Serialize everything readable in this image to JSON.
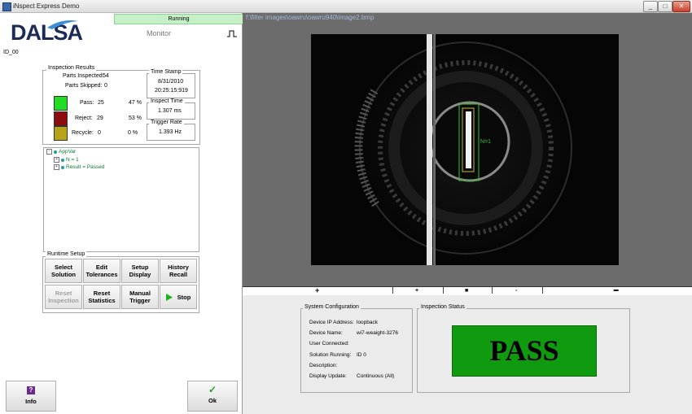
{
  "window": {
    "title": "iNspect Express Demo",
    "controls": [
      "_",
      "□",
      "✕"
    ]
  },
  "status": "Running",
  "logo": "DALSA",
  "monitor_label": "Monitor",
  "id_label": "ID_00",
  "results": {
    "title": "Inspection Results",
    "parts_inspected_label": "Parts Inspected:",
    "parts_inspected": "54",
    "parts_skipped_label": "Parts Skipped:",
    "parts_skipped": "0",
    "rows": [
      {
        "label": "Pass:",
        "count": "25",
        "percent": "47 %",
        "color": "#22dd22"
      },
      {
        "label": "Reject:",
        "count": "29",
        "percent": "53 %",
        "color": "#8b0d0d"
      },
      {
        "label": "Recycle:",
        "count": "0",
        "percent": "0 %",
        "color": "#b8a41c"
      }
    ],
    "timestamp_title": "Time Stamp",
    "date": "8/31/2010",
    "time": "20:25:15:919",
    "inspect_time_title": "Inspect Time",
    "inspect_time": "1.307 ms",
    "trigger_rate_title": "Trigger Rate",
    "trigger_rate": "1.393 Hz"
  },
  "tree": {
    "root": "AppVar",
    "children": [
      "N = 1",
      "Result = Passed"
    ]
  },
  "runtime": {
    "title": "Runtime Setup",
    "buttons": [
      "Select\nSolution",
      "Edit\nTolerances",
      "Setup\nDisplay",
      "History\nRecall",
      "Reset\nInspection",
      "Reset\nStatistics",
      "Manual\nTrigger",
      "Stop"
    ]
  },
  "bottom_buttons": {
    "info_label": "Info",
    "info_icon": "?",
    "ok_label": "Ok",
    "ok_icon": "✓"
  },
  "image": {
    "path": "f:\\filter images\\oawru\\oawru940\\image2.bmp",
    "overlay_label": "N=1"
  },
  "ruler_symbols": [
    "+",
    "+",
    "■",
    "-",
    "━"
  ],
  "system_config": {
    "title": "System Configuration",
    "rows": [
      {
        "key": "Device IP Address:",
        "value": "loopback"
      },
      {
        "key": "Device Name:",
        "value": "wi7-weaight-3276"
      },
      {
        "key": "User Connected:",
        "value": ""
      },
      {
        "key": "Solution Running:",
        "value": "ID 0"
      },
      {
        "key": "Description:",
        "value": ""
      },
      {
        "key": "Display Update:",
        "value": "Continuous (All)"
      }
    ]
  },
  "inspection_status": {
    "title": "Inspection Status",
    "result": "PASS",
    "color": "#0f9a10"
  }
}
